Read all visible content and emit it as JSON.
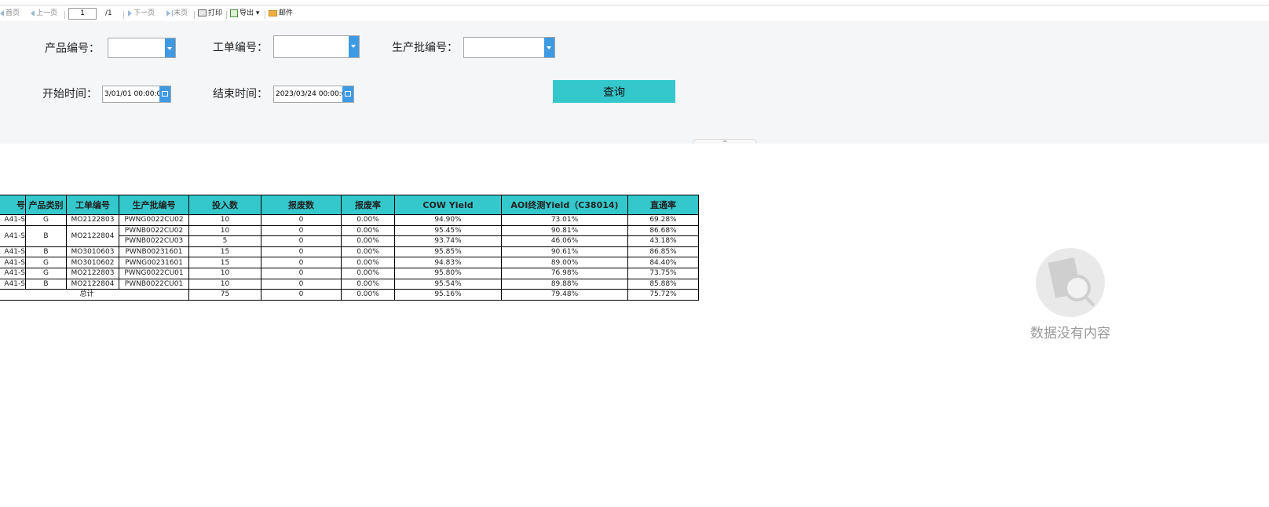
{
  "toolbar": {
    "first": "首页",
    "prev": "上一页",
    "page_value": "1",
    "page_total": "/1",
    "next": "下一页",
    "last": "末页",
    "print": "打印",
    "export": "导出",
    "mail": "邮件"
  },
  "filters": {
    "product_no_label": "产品编号：",
    "work_order_label": "工单编号：",
    "batch_no_label": "生产批编号：",
    "start_label": "开始时间：",
    "start_value": "3/01/01 00:00:00",
    "end_label": "结束时间：",
    "end_value": "2023/03/24 00:00:00",
    "query_button": "查询"
  },
  "table": {
    "headers": [
      "号",
      "产品类别",
      "工单编号",
      "生产批编号",
      "投入数",
      "报废数",
      "报废率",
      "COW Yield",
      "AOI终测Yield（C38014)",
      "直通率"
    ],
    "rows": [
      {
        "product": "A41-S",
        "category": "G",
        "work_order": "MO2122803",
        "batch": "PWNG0022CU02",
        "input": "10",
        "scrap": "0",
        "scrap_rate": "0.00%",
        "cow": "94.90%",
        "aoi": "73.01%",
        "fpy": "69.28%"
      },
      {
        "product": "A41-S",
        "category": "B",
        "work_order": "MO2122804",
        "batch": "PWNB0022CU02",
        "input": "10",
        "scrap": "0",
        "scrap_rate": "0.00%",
        "cow": "95.45%",
        "aoi": "90.81%",
        "fpy": "86.68%"
      },
      {
        "batch": "PWNB0022CU03",
        "input": "5",
        "scrap": "0",
        "scrap_rate": "0.00%",
        "cow": "93.74%",
        "aoi": "46.06%",
        "fpy": "43.18%"
      },
      {
        "product": "A41-S",
        "category": "B",
        "work_order": "MO3010603",
        "batch": "PWNB00231601",
        "input": "15",
        "scrap": "0",
        "scrap_rate": "0.00%",
        "cow": "95.85%",
        "aoi": "90.61%",
        "fpy": "86.85%"
      },
      {
        "product": "A41-S",
        "category": "G",
        "work_order": "MO3010602",
        "batch": "PWNG00231601",
        "input": "15",
        "scrap": "0",
        "scrap_rate": "0.00%",
        "cow": "94.83%",
        "aoi": "89.00%",
        "fpy": "84.40%"
      },
      {
        "product": "A41-S",
        "category": "G",
        "work_order": "MO2122803",
        "batch": "PWNG0022CU01",
        "input": "10",
        "scrap": "0",
        "scrap_rate": "0.00%",
        "cow": "95.80%",
        "aoi": "76.98%",
        "fpy": "73.75%"
      },
      {
        "product": "A41-S",
        "category": "B",
        "work_order": "MO2122804",
        "batch": "PWNB0022CU01",
        "input": "10",
        "scrap": "0",
        "scrap_rate": "0.00%",
        "cow": "95.54%",
        "aoi": "89.88%",
        "fpy": "85.88%"
      }
    ],
    "total": {
      "label": "总计",
      "input": "75",
      "scrap": "0",
      "scrap_rate": "0.00%",
      "cow": "95.16%",
      "aoi": "79.48%",
      "fpy": "75.72%"
    }
  },
  "empty_state": {
    "message": "数据没有内容",
    "icon": "no-data-magnifier-icon"
  },
  "colors": {
    "header_bg": "#34c8cc",
    "button_bg": "#34c8cc",
    "dropdown_button": "#3d9ae3",
    "panel_bg": "#f5f6f8"
  }
}
